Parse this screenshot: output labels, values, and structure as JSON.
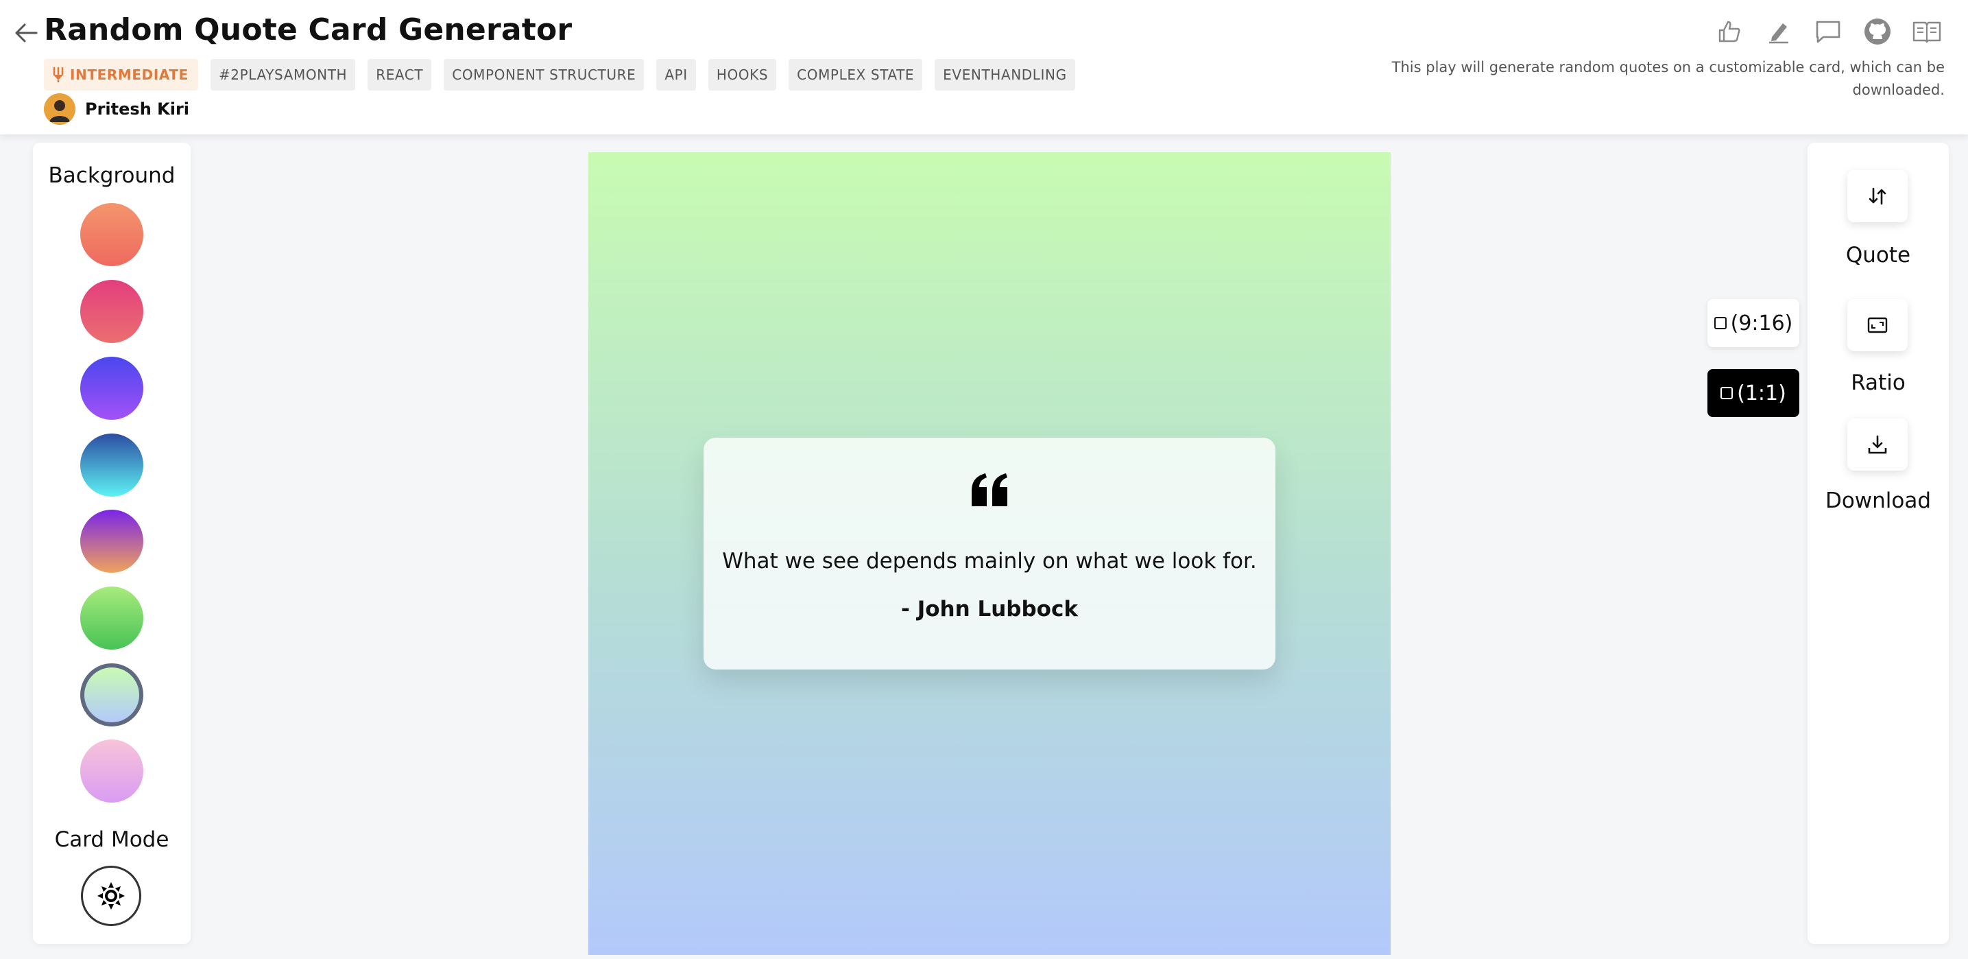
{
  "header": {
    "title": "Random Quote Card Generator",
    "level_tag": "INTERMEDIATE",
    "tags": [
      "#2PLAYSAMONTH",
      "REACT",
      "COMPONENT STRUCTURE",
      "API",
      "HOOKS",
      "COMPLEX STATE",
      "EVENTHANDLING"
    ],
    "author": "Pritesh Kiri",
    "description": "This play will generate random quotes on a customizable card, which can be downloaded.",
    "icons": [
      "like-icon",
      "edit-icon",
      "comment-icon",
      "github-icon",
      "docs-icon"
    ]
  },
  "left_panel": {
    "background_title": "Background",
    "swatches": [
      {
        "from": "#f4956c",
        "to": "#ee6a5f"
      },
      {
        "from": "#e33e7f",
        "to": "#eb6f6f"
      },
      {
        "from": "#4a47ee",
        "to": "#a451f7"
      },
      {
        "from": "#2c4da2",
        "to": "#5ef2f4"
      },
      {
        "from": "#7a25e8",
        "to": "#f0a35b"
      },
      {
        "from": "#a8eb7c",
        "to": "#48c357"
      },
      {
        "from": "#c8fbb2",
        "to": "#b3c9fb"
      },
      {
        "from": "#f7c4d8",
        "to": "#d99cf3"
      }
    ],
    "selected_swatch": 6,
    "card_mode_title": "Card Mode"
  },
  "canvas": {
    "gradient": {
      "from": "#c8fbb2",
      "to": "#b3c9fb"
    },
    "quote": "What we see depends mainly on what we look for.",
    "author": "- John Lubbock"
  },
  "ratio_options": [
    {
      "label": "(9:16)",
      "selected": false
    },
    {
      "label": "(1:1)",
      "selected": true
    }
  ],
  "right_panel": {
    "quote_label": "Quote",
    "ratio_label": "Ratio",
    "download_label": "Download"
  },
  "colors": {
    "accent_orange": "#e2793b",
    "selected_ring": "#5f6a80"
  }
}
